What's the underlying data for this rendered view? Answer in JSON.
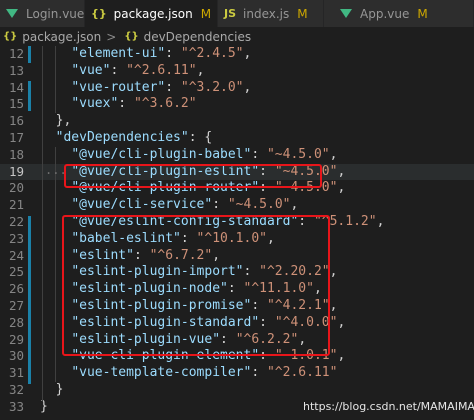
{
  "tabs": [
    {
      "icon": "vue-icon",
      "label": "Login.vue",
      "status": "U"
    },
    {
      "icon": "json-icon",
      "icon_text": "{}",
      "label": "package.json",
      "status": "M",
      "active": true
    },
    {
      "icon": "js-icon",
      "icon_text": "JS",
      "label": "index.js",
      "status": "M"
    },
    {
      "icon": "vue-icon",
      "label": "App.vue",
      "status": "M"
    }
  ],
  "breadcrumb": {
    "file": "package.json",
    "separator": ">",
    "icon_text": "{}",
    "section": "devDependencies"
  },
  "lines": [
    {
      "n": "12",
      "parts": [
        [
          "pun",
          "    "
        ],
        [
          "key",
          "\"element-ui\""
        ],
        [
          "pun",
          ": "
        ],
        [
          "str",
          "\"^2.4.5\""
        ],
        [
          "pun",
          ","
        ]
      ]
    },
    {
      "n": "13",
      "parts": [
        [
          "pun",
          "    "
        ],
        [
          "key",
          "\"vue\""
        ],
        [
          "pun",
          ": "
        ],
        [
          "str",
          "\"^2.6.11\""
        ],
        [
          "pun",
          ","
        ]
      ]
    },
    {
      "n": "14",
      "parts": [
        [
          "pun",
          "    "
        ],
        [
          "key",
          "\"vue-router\""
        ],
        [
          "pun",
          ": "
        ],
        [
          "str",
          "\"^3.2.0\""
        ],
        [
          "pun",
          ","
        ]
      ]
    },
    {
      "n": "15",
      "parts": [
        [
          "pun",
          "    "
        ],
        [
          "key",
          "\"vuex\""
        ],
        [
          "pun",
          ": "
        ],
        [
          "str",
          "\"^3.6.2\""
        ]
      ]
    },
    {
      "n": "16",
      "parts": [
        [
          "pun",
          "  },"
        ]
      ]
    },
    {
      "n": "17",
      "parts": [
        [
          "pun",
          "  "
        ],
        [
          "key",
          "\"devDependencies\""
        ],
        [
          "pun",
          ": {"
        ]
      ]
    },
    {
      "n": "18",
      "parts": [
        [
          "pun",
          "    "
        ],
        [
          "key",
          "\"@vue/cli-plugin-babel\""
        ],
        [
          "pun",
          ": "
        ],
        [
          "str",
          "\"~4.5.0\""
        ],
        [
          "pun",
          ","
        ]
      ]
    },
    {
      "n": "19",
      "parts": [
        [
          "pun",
          "    "
        ],
        [
          "key",
          "\"@vue/cli-plugin-eslint\""
        ],
        [
          "pun",
          ": "
        ],
        [
          "str",
          "\"~4.5.0\""
        ],
        [
          "pun",
          ","
        ]
      ]
    },
    {
      "n": "20",
      "parts": [
        [
          "pun",
          "    "
        ],
        [
          "key",
          "\"@vue/cli-plugin-router\""
        ],
        [
          "pun",
          ": "
        ],
        [
          "str",
          "\"~4.5.0\""
        ],
        [
          "pun",
          ","
        ]
      ]
    },
    {
      "n": "21",
      "parts": [
        [
          "pun",
          "    "
        ],
        [
          "key",
          "\"@vue/cli-service\""
        ],
        [
          "pun",
          ": "
        ],
        [
          "str",
          "\"~4.5.0\""
        ],
        [
          "pun",
          ","
        ]
      ]
    },
    {
      "n": "22",
      "parts": [
        [
          "pun",
          "    "
        ],
        [
          "key",
          "\"@vue/eslint-config-standard\""
        ],
        [
          "pun",
          ": "
        ],
        [
          "str",
          "\"^5.1.2\""
        ],
        [
          "pun",
          ","
        ]
      ]
    },
    {
      "n": "23",
      "parts": [
        [
          "pun",
          "    "
        ],
        [
          "key",
          "\"babel-eslint\""
        ],
        [
          "pun",
          ": "
        ],
        [
          "str",
          "\"^10.1.0\""
        ],
        [
          "pun",
          ","
        ]
      ]
    },
    {
      "n": "24",
      "parts": [
        [
          "pun",
          "    "
        ],
        [
          "key",
          "\"eslint\""
        ],
        [
          "pun",
          ": "
        ],
        [
          "str",
          "\"^6.7.2\""
        ],
        [
          "pun",
          ","
        ]
      ]
    },
    {
      "n": "25",
      "parts": [
        [
          "pun",
          "    "
        ],
        [
          "key",
          "\"eslint-plugin-import\""
        ],
        [
          "pun",
          ": "
        ],
        [
          "str",
          "\"^2.20.2\""
        ],
        [
          "pun",
          ","
        ]
      ]
    },
    {
      "n": "26",
      "parts": [
        [
          "pun",
          "    "
        ],
        [
          "key",
          "\"eslint-plugin-node\""
        ],
        [
          "pun",
          ": "
        ],
        [
          "str",
          "\"^11.1.0\""
        ],
        [
          "pun",
          ","
        ]
      ]
    },
    {
      "n": "27",
      "parts": [
        [
          "pun",
          "    "
        ],
        [
          "key",
          "\"eslint-plugin-promise\""
        ],
        [
          "pun",
          ": "
        ],
        [
          "str",
          "\"^4.2.1\""
        ],
        [
          "pun",
          ","
        ]
      ]
    },
    {
      "n": "28",
      "parts": [
        [
          "pun",
          "    "
        ],
        [
          "key",
          "\"eslint-plugin-standard\""
        ],
        [
          "pun",
          ": "
        ],
        [
          "str",
          "\"^4.0.0\""
        ],
        [
          "pun",
          ","
        ]
      ]
    },
    {
      "n": "29",
      "parts": [
        [
          "pun",
          "    "
        ],
        [
          "key",
          "\"eslint-plugin-vue\""
        ],
        [
          "pun",
          ": "
        ],
        [
          "str",
          "\"^6.2.2\""
        ],
        [
          "pun",
          ","
        ]
      ]
    },
    {
      "n": "30",
      "parts": [
        [
          "pun",
          "    "
        ],
        [
          "key",
          "\"vue-cli-plugin-element\""
        ],
        [
          "pun",
          ": "
        ],
        [
          "str",
          "\"~1.0.1\""
        ],
        [
          "pun",
          ","
        ]
      ]
    },
    {
      "n": "31",
      "parts": [
        [
          "pun",
          "    "
        ],
        [
          "key",
          "\"vue-template-compiler\""
        ],
        [
          "pun",
          ": "
        ],
        [
          "str",
          "\"^2.6.11\""
        ]
      ]
    },
    {
      "n": "32",
      "parts": [
        [
          "pun",
          "  }"
        ]
      ]
    },
    {
      "n": "33",
      "parts": [
        [
          "pun",
          "}"
        ]
      ]
    }
  ],
  "current_line": "19",
  "fold_marker": "...",
  "watermark": "https://blog.csdn.net/MAMAIMAI",
  "colors": {
    "key": "#9cdcfe",
    "string": "#ce9178",
    "punctuation": "#d4d4d4",
    "highlight_box": "#e8151a",
    "modified": "#cca700",
    "vue": "#41b883",
    "json_icon": "#cbcb41",
    "js_icon": "#cbcb41"
  }
}
